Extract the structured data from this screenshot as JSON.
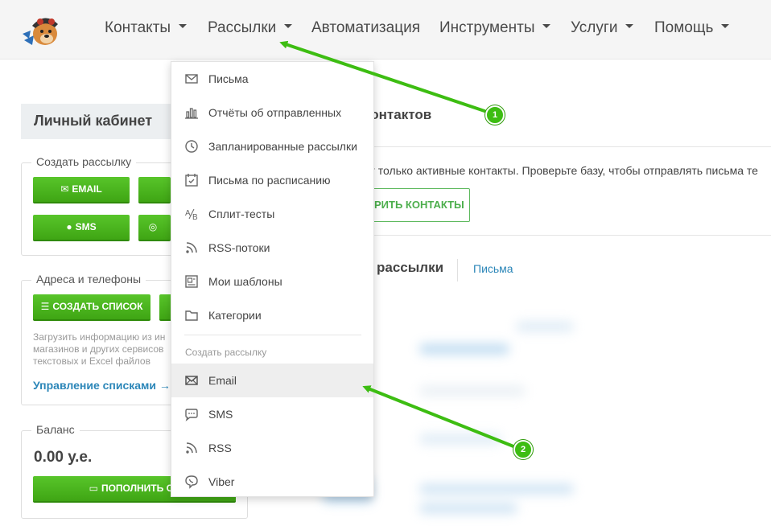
{
  "nav": {
    "items": [
      {
        "label": "Контакты",
        "has_caret": true
      },
      {
        "label": "Рассылки",
        "has_caret": true
      },
      {
        "label": "Автоматизация",
        "has_caret": false
      },
      {
        "label": "Инструменты",
        "has_caret": true
      },
      {
        "label": "Услуги",
        "has_caret": true
      },
      {
        "label": "Помощь",
        "has_caret": true
      }
    ]
  },
  "sidebar": {
    "title": "Личный кабинет",
    "create_mailing": {
      "legend": "Создать рассылку",
      "email_button": "EMAIL",
      "sms_button": "SMS"
    },
    "addresses": {
      "legend": "Адреса и телефоны",
      "create_list_button": "СОЗДАТЬ СПИСОК",
      "description_lines": [
        "Загрузить информацию из ин",
        "магазинов и других сервисов",
        "текстовых и Excel файлов"
      ],
      "manage_link": "Управление списками →"
    },
    "balance": {
      "legend": "Баланс",
      "value": "0.00 у.е.",
      "topup_button": "ПОПОЛНИТЬ СЧ"
    }
  },
  "main": {
    "contacts_title": "контактов",
    "warning_text": "от только активные контакты. Проверьте базу, чтобы отправлять письма те",
    "check_button": "РИТЬ КОНТАКТЫ",
    "mailings_title": "рассылки",
    "letters_tab": "Письма"
  },
  "dropdown": {
    "items": [
      {
        "label": "Письма",
        "icon": "envelope-icon"
      },
      {
        "label": "Отчёты об отправленных",
        "icon": "bar-chart-icon"
      },
      {
        "label": "Запланированные рассылки",
        "icon": "clock-icon"
      },
      {
        "label": "Письма по расписанию",
        "icon": "calendar-check-icon"
      },
      {
        "label": "Сплит-тесты",
        "icon": "ab-test-icon"
      },
      {
        "label": "RSS-потоки",
        "icon": "rss-icon"
      },
      {
        "label": "Мои шаблоны",
        "icon": "template-icon"
      },
      {
        "label": "Категории",
        "icon": "folder-icon"
      }
    ],
    "create_header": "Создать рассылку",
    "create_items": [
      {
        "label": "Email",
        "icon": "envelope-icon"
      },
      {
        "label": "SMS",
        "icon": "sms-bubble-icon"
      },
      {
        "label": "RSS",
        "icon": "rss-icon"
      },
      {
        "label": "Viber",
        "icon": "viber-icon"
      }
    ]
  },
  "annotations": {
    "badge_1": "1",
    "badge_2": "2",
    "arrow_color": "#3dbd12"
  }
}
